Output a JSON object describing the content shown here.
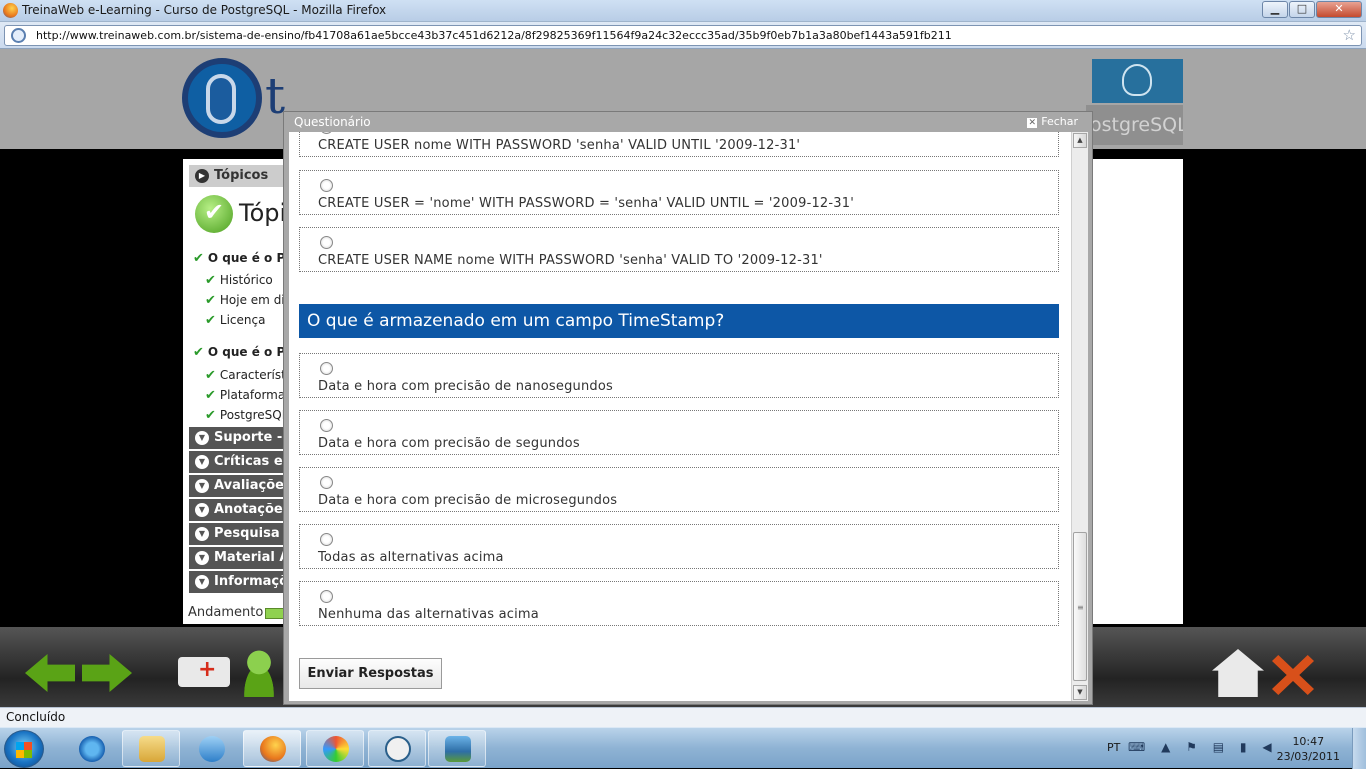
{
  "window": {
    "title": "TreinaWeb e-Learning - Curso de PostgreSQL - Mozilla Firefox",
    "min": "▁",
    "max": "□",
    "close": "✕"
  },
  "browser": {
    "url": "http://www.treinaweb.com.br/sistema-de-ensino/fb41708a61ae5bcce43b37c451d6212a/8f29825369f11564f9a24c32eccc35ad/35b9f0eb7b1a3a80bef1443a591fb211",
    "bookmark_icon": "☆"
  },
  "site": {
    "logo_text": "t",
    "pg_text": "ostgreSQL"
  },
  "sidebar": {
    "topicos_label": "Tópicos",
    "big_title": "Tópi",
    "check_glyph": "✔",
    "check_small": "✔",
    "arrow_glyph": "▶",
    "arrow_down": "▼",
    "topics": [
      {
        "label": "O que é o Po"
      },
      {
        "label": "Histórico"
      },
      {
        "label": "Hoje em di"
      },
      {
        "label": "Licença"
      },
      {
        "label": "O que é o Po"
      },
      {
        "label": "Característi"
      },
      {
        "label": "Plataformas"
      },
      {
        "label": "PostgreSQL"
      }
    ],
    "sections": [
      "Suporte - P",
      "Críticas e su",
      "Avaliações",
      "Anotações",
      "Pesquisa de",
      "Material Ad",
      "Informaçõe"
    ],
    "andamento_label": "Andamento"
  },
  "modal": {
    "title": "Questionário",
    "close_label": "Fechar",
    "close_x": "✕",
    "prev_options": [
      "CREATE USER nome WITH PASSWORD 'senha' VALID UNTIL '2009-12-31'",
      "CREATE USER = 'nome' WITH PASSWORD = 'senha' VALID UNTIL = '2009-12-31'",
      "CREATE USER NAME nome WITH PASSWORD 'senha' VALID TO '2009-12-31'"
    ],
    "question": "O que é armazenado em um campo TimeStamp?",
    "options": [
      "Data e hora com precisão de nanosegundos",
      "Data e hora com precisão de segundos",
      "Data e hora com precisão de microsegundos",
      "Todas as alternativas acima",
      "Nenhuma das alternativas acima"
    ],
    "submit_label": "Enviar Respostas",
    "scroll_up": "▲",
    "scroll_down": "▼",
    "scroll_grip": "≡"
  },
  "status": {
    "text": "Concluído"
  },
  "taskbar": {
    "lang": "PT",
    "tray_icons": "⌨ ▲ ⚑ ▤ ▮ ◀",
    "time": "10:47",
    "date": "23/03/2011"
  }
}
